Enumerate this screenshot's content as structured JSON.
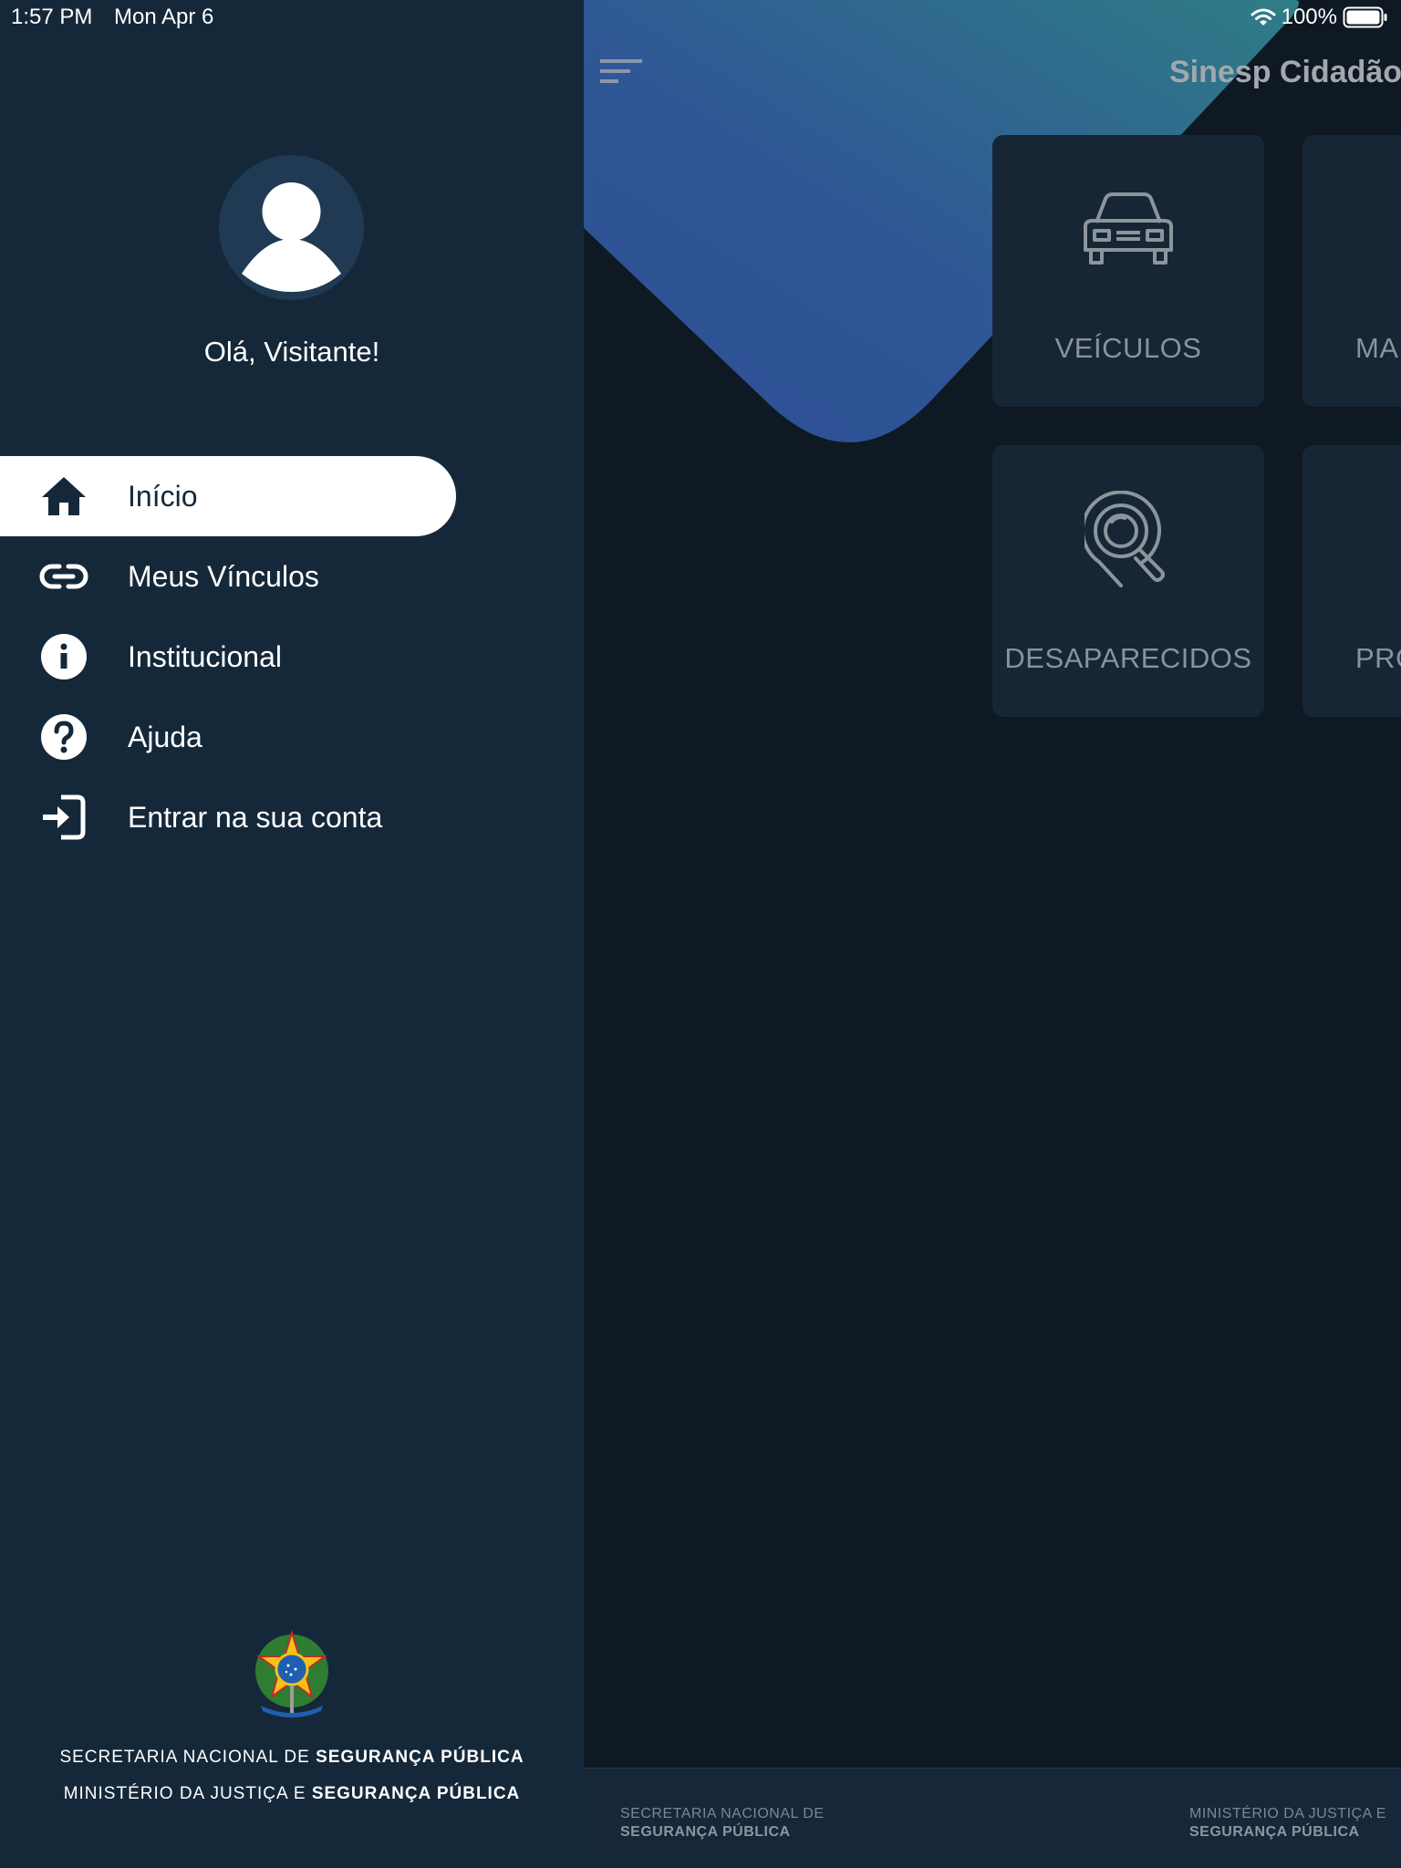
{
  "status_bar": {
    "time": "1:57 PM",
    "date": "Mon Apr 6",
    "battery": "100%"
  },
  "drawer": {
    "greeting": "Olá, Visitante!",
    "nav_items": [
      {
        "label": "Início",
        "icon": "home-icon",
        "active": true
      },
      {
        "label": "Meus Vínculos",
        "icon": "link-icon",
        "active": false
      },
      {
        "label": "Institucional",
        "icon": "info-icon",
        "active": false
      },
      {
        "label": "Ajuda",
        "icon": "help-icon",
        "active": false
      },
      {
        "label": "Entrar na sua conta",
        "icon": "login-icon",
        "active": false
      }
    ],
    "footer": {
      "line1_prefix": "SECRETARIA NACIONAL DE ",
      "line1_bold": "SEGURANÇA PÚBLICA",
      "line2_prefix": "MINISTÉRIO DA JUSTIÇA E ",
      "line2_bold": "SEGURANÇA PÚBLICA"
    }
  },
  "main": {
    "title": "Sinesp Cidadão",
    "tiles": [
      {
        "label": "VEÍCULOS",
        "icon": "car-icon"
      },
      {
        "label": "MA",
        "icon": "document-icon"
      },
      {
        "label": "DESAPARECIDOS",
        "icon": "search-location-icon"
      },
      {
        "label": "PRO",
        "icon": "document-icon"
      }
    ],
    "footer": {
      "left_line1": "SECRETARIA NACIONAL DE",
      "left_line2": "SEGURANÇA PÚBLICA",
      "right_line1": "MINISTÉRIO DA JUSTIÇA E",
      "right_line2": "SEGURANÇA PÚBLICA"
    }
  },
  "colors": {
    "drawer_bg": "#15283a",
    "main_bg": "#0e1923",
    "tile_bg": "#162635",
    "accent_blue": "#2e5496",
    "accent_teal": "#2f7a86"
  }
}
